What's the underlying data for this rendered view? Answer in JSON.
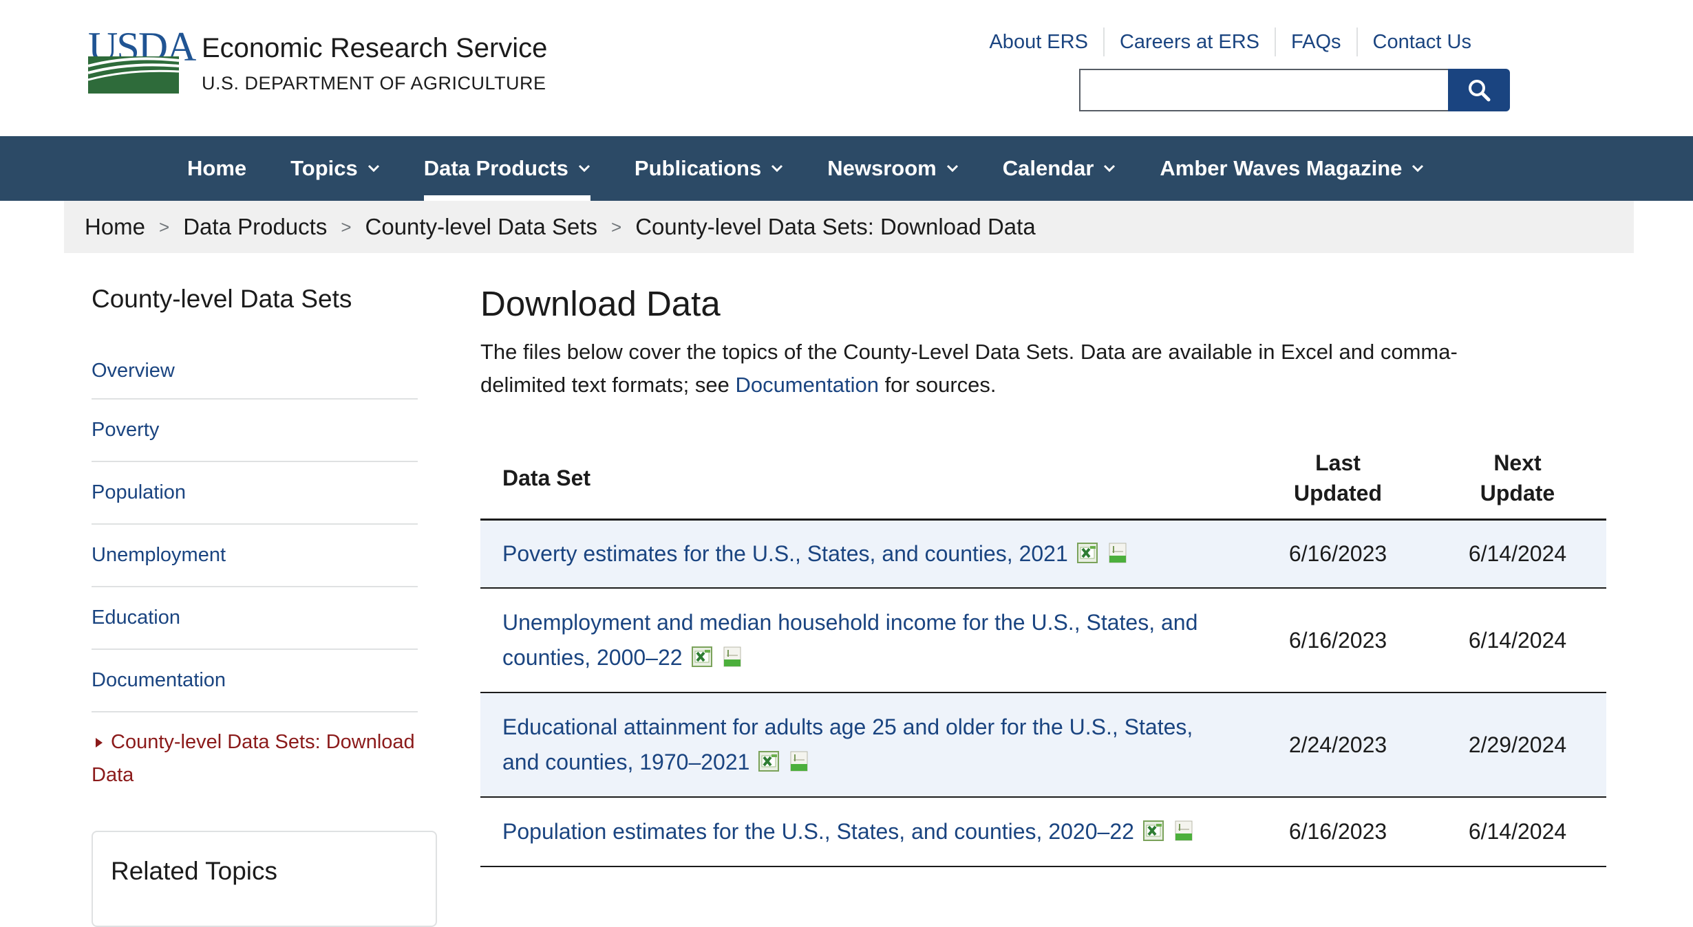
{
  "header": {
    "logo_text": "USDA",
    "agency_name": "Economic Research Service",
    "department": "U.S. DEPARTMENT OF AGRICULTURE",
    "utility_links": [
      "About ERS",
      "Careers at ERS",
      "FAQs",
      "Contact Us"
    ],
    "search": {
      "value": "",
      "placeholder": ""
    }
  },
  "nav": {
    "items": [
      {
        "label": "Home",
        "dropdown": false
      },
      {
        "label": "Topics",
        "dropdown": true
      },
      {
        "label": "Data Products",
        "dropdown": true,
        "active": true
      },
      {
        "label": "Publications",
        "dropdown": true
      },
      {
        "label": "Newsroom",
        "dropdown": true
      },
      {
        "label": "Calendar",
        "dropdown": true
      },
      {
        "label": "Amber Waves Magazine",
        "dropdown": true
      }
    ]
  },
  "breadcrumb": [
    "Home",
    "Data Products",
    "County-level Data Sets",
    "County-level Data Sets: Download Data"
  ],
  "breadcrumb_separator": ">",
  "sidebar": {
    "title": "County-level Data Sets",
    "items": [
      "Overview",
      "Poverty",
      "Population",
      "Unemployment",
      "Education",
      "Documentation"
    ],
    "current": "County-level Data Sets: Download Data",
    "related_title": "Related Topics"
  },
  "main": {
    "title": "Download Data",
    "intro_before": "The files below cover the topics of the County-Level Data Sets. Data are available in Excel and comma-delimited text formats; see ",
    "intro_link": "Documentation",
    "intro_after": " for sources.",
    "table": {
      "headers": {
        "dataset": "Data Set",
        "last_updated": "Last Updated",
        "next_update": "Next Update"
      },
      "rows": [
        {
          "name": "Poverty estimates for the U.S., States, and counties, 2021",
          "last_updated": "6/16/2023",
          "next_update": "6/14/2024"
        },
        {
          "name": "Unemployment and median household income for the U.S., States, and counties, 2000–22",
          "last_updated": "6/16/2023",
          "next_update": "6/14/2024"
        },
        {
          "name": "Educational attainment for adults age 25 and older for the U.S., States, and counties, 1970–2021",
          "last_updated": "2/24/2023",
          "next_update": "2/29/2024"
        },
        {
          "name": "Population estimates for the U.S., States, and counties, 2020–22",
          "last_updated": "6/16/2023",
          "next_update": "6/14/2024"
        }
      ],
      "row_icons": [
        "excel-file-icon",
        "csv-file-icon"
      ]
    }
  },
  "colors": {
    "nav_bg": "#2c4a66",
    "link": "#1a4480",
    "current_item": "#8b1a1a",
    "row_shade": "#eef3fa",
    "breadcrumb_bg": "#f0f0f0",
    "usda_blue": "#205493",
    "usda_green": "#2e6b3a"
  }
}
